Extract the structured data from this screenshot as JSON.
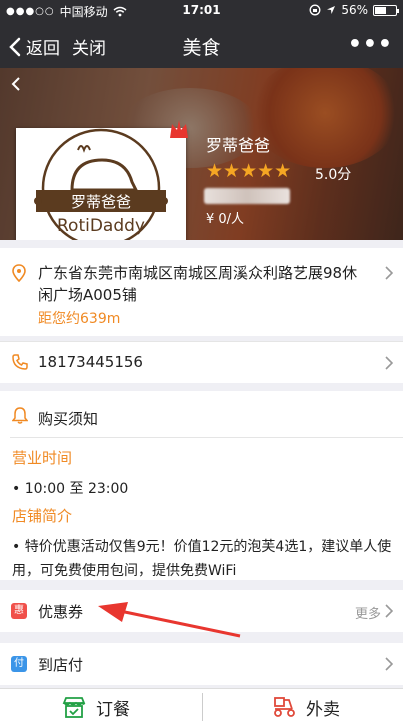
{
  "status_bar": {
    "carrier": "中国移动",
    "time": "17:01",
    "battery_percent": "56%",
    "battery_level": 0.56
  },
  "nav": {
    "back_label": "返回",
    "close_label": "关闭",
    "title": "美食",
    "more_label": "•••"
  },
  "shop": {
    "name": "罗蒂爸爸",
    "logo_cn": "罗蒂爸爸",
    "logo_en": "RotiDaddy",
    "stars": "★★★★★",
    "rating": "5.0分",
    "price": "¥ 0/人"
  },
  "address": {
    "text": "广东省东莞市南城区南城区周溪众利路艺展98休闲广场A005铺",
    "distance": "距您约639m"
  },
  "phone": {
    "number": "18173445156"
  },
  "notice": {
    "title": "购买须知",
    "hours_label": "营业时间",
    "hours": "• 10:00 至 23:00",
    "intro_label": "店铺简介",
    "intro": "• 特价优惠活动仅售9元！价值12元的泡芙4选1，建议单人使用，可免费使用包间，提供免费WiFi"
  },
  "coupon": {
    "badge": "惠",
    "label": "优惠券",
    "more": "更多"
  },
  "pay": {
    "badge": "付",
    "label": "到店付"
  },
  "bottom": {
    "order_label": "订餐",
    "takeout_label": "外卖"
  },
  "colors": {
    "accent_orange": "#f08a24",
    "coupon_red": "#f0504a",
    "pay_blue": "#3b95e8",
    "order_green": "#22a045",
    "takeout_red": "#e0493a",
    "star": "#f5a623",
    "annotation_arrow": "#e8362f"
  }
}
